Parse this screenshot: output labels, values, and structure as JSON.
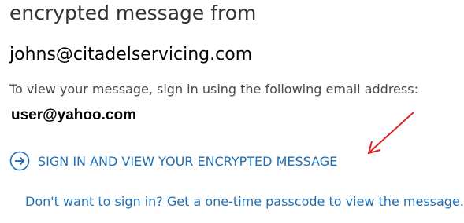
{
  "message": {
    "heading": "encrypted message from",
    "sender": "johns@citadelservicing.com",
    "instructions": "To view your message, sign in using the following email address:",
    "recipient_email": "user@yahoo.com"
  },
  "actions": {
    "sign_in_label": "SIGN IN AND VIEW YOUR ENCRYPTED MESSAGE",
    "sign_in_icon": "arrow-right-circle-icon",
    "passcode_label": "Don't want to sign in? Get a one-time passcode to view the message."
  },
  "colors": {
    "link": "#1f6fb5",
    "annotation": "#e02020"
  }
}
